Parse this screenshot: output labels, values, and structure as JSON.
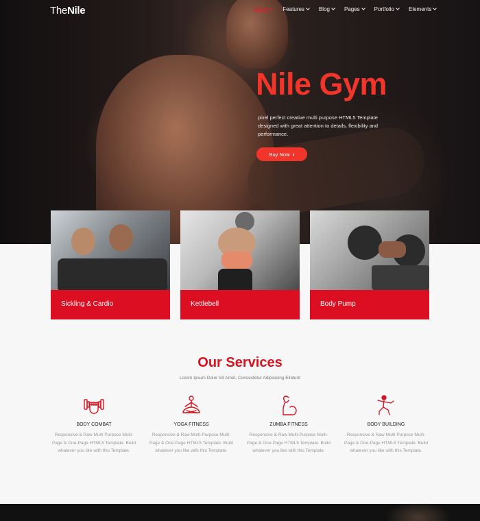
{
  "nav": {
    "logo_light": "The",
    "logo_bold": "Nile",
    "items": [
      {
        "label": "Home",
        "active": true
      },
      {
        "label": "Features"
      },
      {
        "label": "Blog"
      },
      {
        "label": "Pages"
      },
      {
        "label": "Portfolio"
      },
      {
        "label": "Elements"
      }
    ]
  },
  "hero": {
    "title": "Nile Gym",
    "description": "pixel perfect creative multi purpose HTML5 Template designed with great attention to details, flexibility and performance.",
    "button": "Buy Now"
  },
  "cards": [
    {
      "label": "Sickling & Cardio"
    },
    {
      "label": "Kettlebell"
    },
    {
      "label": "Body Pump"
    }
  ],
  "services": {
    "title": "Our Services",
    "subtitle": "Lorem Ipsum Dolor Sit Amet, Consectetur Adipisicing Elitdunt",
    "items": [
      {
        "name": "BODY COMBAT",
        "icon": "dumbbell-fist-icon",
        "text": "Responsive & Raw Multi-Purpose Multi-Page & One-Page HTML5 Template. Build whatever you like with this Template."
      },
      {
        "name": "YOGA FITNESS",
        "icon": "yoga-icon",
        "text": "Responsive & Raw Multi-Purpose Multi-Page & One-Page HTML5 Template. Build whatever you like with this Template."
      },
      {
        "name": "ZUMBA FITNESS",
        "icon": "flexed-arm-icon",
        "text": "Responsive & Raw Multi-Purpose Multi-Page & One-Page HTML5 Template. Build whatever you like with this Template."
      },
      {
        "name": "BODY BUILDING",
        "icon": "martial-arts-icon",
        "text": "Responsive & Raw Multi-Purpose Multi-Page & One-Page HTML5 Template. Build whatever you like with this Template."
      }
    ]
  },
  "colors": {
    "accent": "#dc0e22",
    "title_red": "#f2352b",
    "dark": "#1a1414"
  }
}
